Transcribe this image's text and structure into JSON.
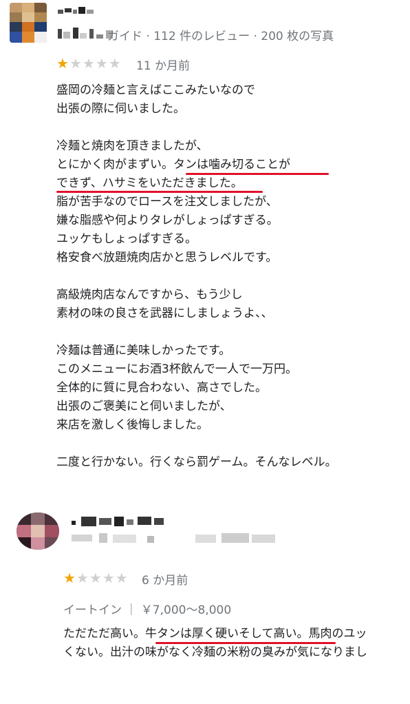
{
  "review1": {
    "reviewer_subtitle": "ガイド · 112 件のレビュー · 200 枚の写真",
    "rating": 1,
    "rating_max": 5,
    "time": "11 か月前",
    "lines": [
      "盛岡の冷麺と言えばここみたいなので",
      "出張の際に伺いました。",
      "",
      "冷麺と焼肉を頂きましたが、",
      "とにかく肉がまずい。タンは噛み切ることが",
      "できず、ハサミをいただきました。",
      "脂が苦手なのでロースを注文しましたが、",
      "嫌な脂感や何よりタレがしょっぱすぎる。",
      "ユッケもしょっぱすぎる。",
      "格安食べ放題焼肉店かと思うレベルです。",
      "",
      "高級焼肉店なんですから、もう少し",
      "素材の味の良さを武器にしましょうよ、、",
      "",
      "冷麺は普通に美味しかったです。",
      "このメニューにお酒3杯飲んで一人で一万円。",
      "全体的に質に見合わない、高さでした。",
      "出張のご褒美にと伺いましたが、",
      "来店を激しく後悔しました。",
      "",
      "二度と行かない。行くなら罰ゲーム。そんなレベル。"
    ]
  },
  "review2": {
    "rating": 1,
    "rating_max": 5,
    "time": "6 か月前",
    "service": "イートイン ｜ ￥7,000～8,000",
    "lines": [
      "ただただ高い。牛タンは厚く硬いそして高い。馬肉のユッ",
      "くない。出汁の味がなく冷麺の米粉の臭みが気になりまし"
    ]
  },
  "colors": {
    "star_filled": "#f0a500",
    "star_empty": "#d0d0d0",
    "underline": "#e0112b",
    "meta_text": "#70757a"
  }
}
